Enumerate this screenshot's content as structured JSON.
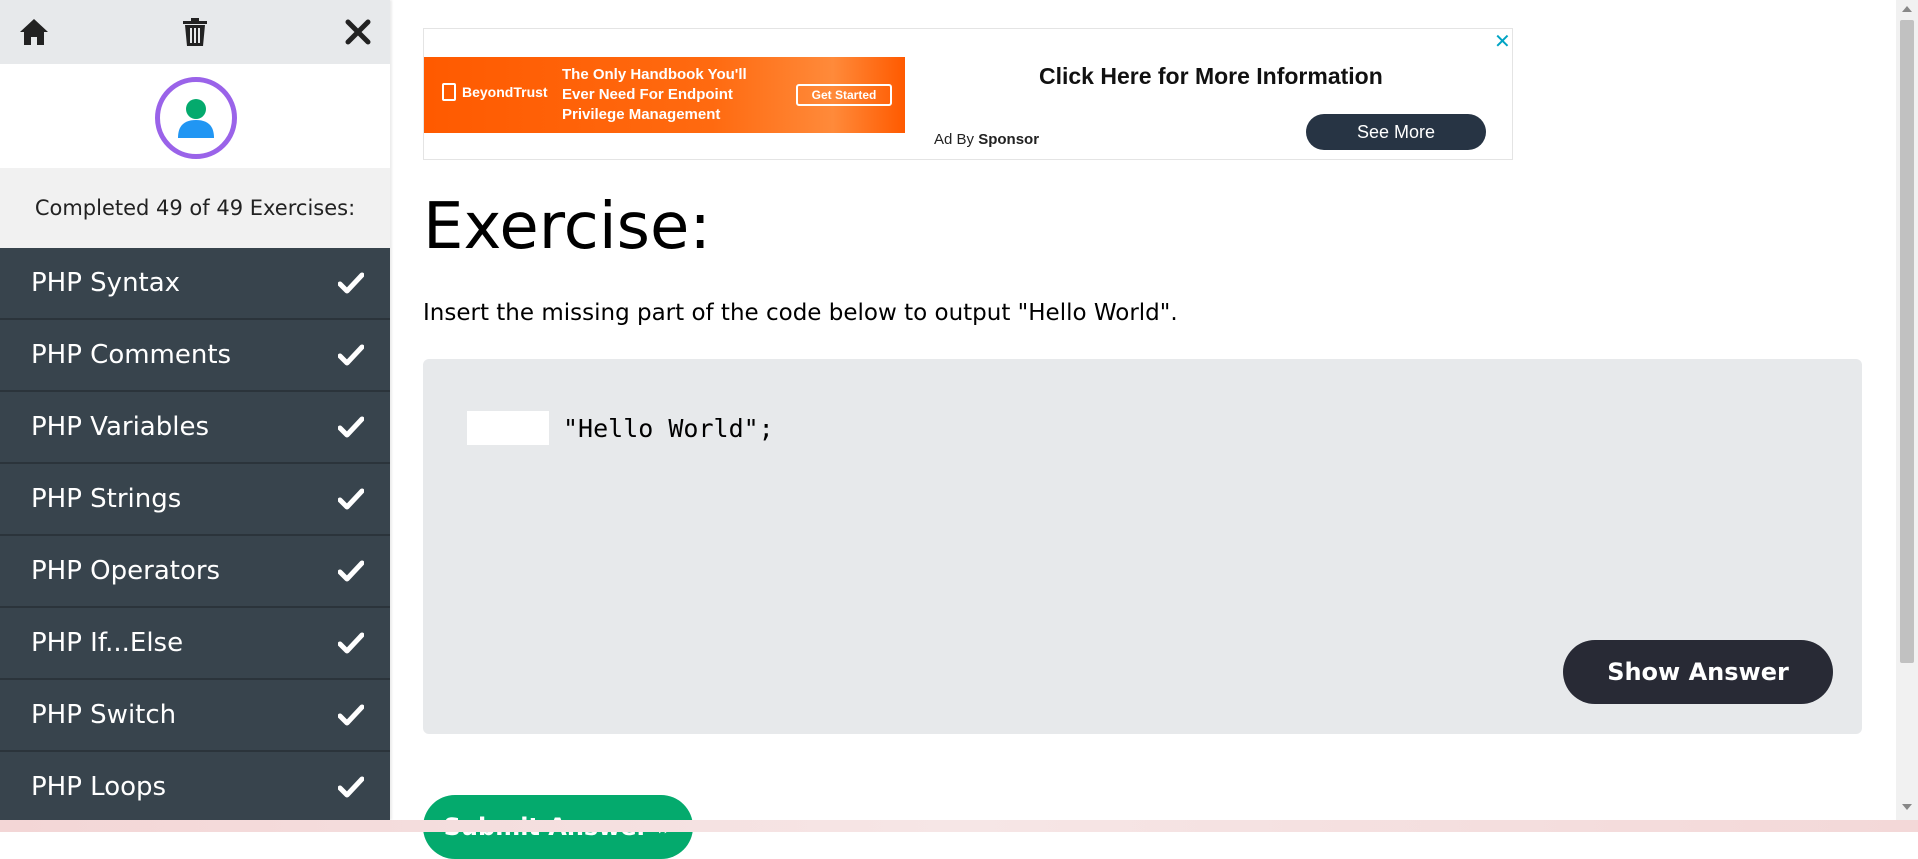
{
  "sidebar": {
    "progress_text": "Completed 49 of 49 Exercises:",
    "items": [
      {
        "label": "PHP Syntax"
      },
      {
        "label": "PHP Comments"
      },
      {
        "label": "PHP Variables"
      },
      {
        "label": "PHP Strings"
      },
      {
        "label": "PHP Operators"
      },
      {
        "label": "PHP If...Else"
      },
      {
        "label": "PHP Switch"
      },
      {
        "label": "PHP Loops"
      }
    ],
    "icons": [
      "home-icon",
      "trash-icon",
      "close-icon",
      "user-icon",
      "check-icon"
    ],
    "item_bg": "#38444d",
    "avatar_ring": "#9a63e9"
  },
  "ad": {
    "brand": "BeyondTrust",
    "headline": "The Only Handbook You'll Ever Need For Endpoint Privilege Management",
    "cta": "Get Started",
    "title": "Click Here for More Information",
    "by_prefix": "Ad By",
    "by_sponsor": "Sponsor",
    "see_more": "See More",
    "close": "✕"
  },
  "main": {
    "heading": "Exercise:",
    "instruction": "Insert the missing part of the code below to output \"Hello World\".",
    "code_suffix": "\"Hello World\";",
    "input_value": "",
    "show_answer": "Show Answer",
    "submit": "Submit Answer »",
    "accent": "#04aa6d"
  }
}
